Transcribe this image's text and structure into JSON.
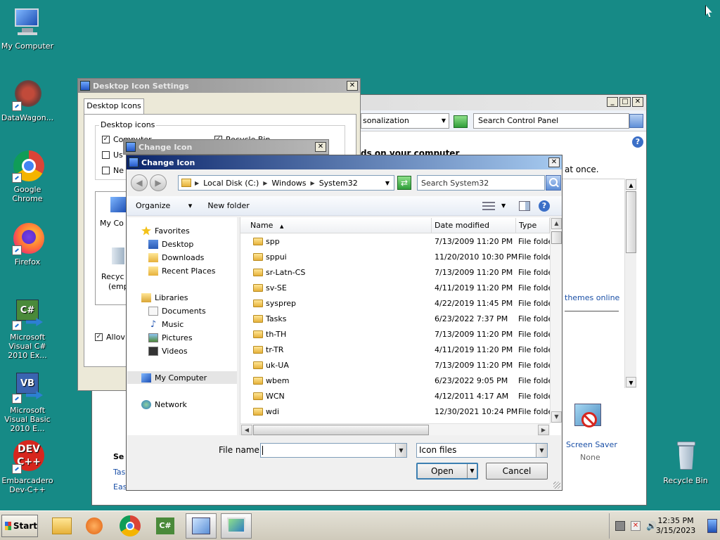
{
  "desktop": {
    "icons": [
      {
        "label": "My Computer"
      },
      {
        "label": "DataWagon..."
      },
      {
        "label": "Google Chrome"
      },
      {
        "label": "Firefox"
      },
      {
        "label": "Microsoft Visual C# 2010 Ex..."
      },
      {
        "label": "Microsoft Visual Basic 2010 E..."
      },
      {
        "label": "Embarcadero Dev-C++"
      },
      {
        "label": "Recycle Bin"
      }
    ]
  },
  "personalization_window": {
    "breadcrumb_tail": "sonalization",
    "search_placeholder": "Search Control Panel",
    "heading_fragment": "ds on your computer",
    "text_fragment": "at once.",
    "themes_link": "themes online",
    "screen_saver_label": "Screen Saver",
    "screen_saver_value": "None",
    "left_fragments": [
      "Se",
      "Tas",
      "Eas"
    ]
  },
  "desktop_icon_settings": {
    "title": "Desktop Icon Settings",
    "tab": "Desktop Icons",
    "group_label": "Desktop icons",
    "checks": [
      "Computer",
      "Recycle Bin",
      "Us",
      "Ne"
    ],
    "preview_labels": [
      "My Co",
      "Recyc",
      "(emp"
    ],
    "allow_label": "Allov"
  },
  "change_icon_back": {
    "title": "Change Icon"
  },
  "change_icon": {
    "title": "Change Icon",
    "address": [
      "Local Disk (C:)",
      "Windows",
      "System32"
    ],
    "search_placeholder": "Search System32",
    "toolbar": {
      "organize": "Organize",
      "new_folder": "New folder"
    },
    "nav": {
      "favorites": "Favorites",
      "desktop": "Desktop",
      "downloads": "Downloads",
      "recent": "Recent Places",
      "libraries": "Libraries",
      "documents": "Documents",
      "music": "Music",
      "pictures": "Pictures",
      "videos": "Videos",
      "my_computer": "My Computer",
      "network": "Network"
    },
    "columns": {
      "name": "Name",
      "date": "Date modified",
      "type": "Type"
    },
    "rows": [
      {
        "name": "spp",
        "date": "7/13/2009 11:20 PM",
        "type": "File folder"
      },
      {
        "name": "sppui",
        "date": "11/20/2010 10:30 PM",
        "type": "File folder"
      },
      {
        "name": "sr-Latn-CS",
        "date": "7/13/2009 11:20 PM",
        "type": "File folder"
      },
      {
        "name": "sv-SE",
        "date": "4/11/2019 11:20 PM",
        "type": "File folder"
      },
      {
        "name": "sysprep",
        "date": "4/22/2019 11:45 PM",
        "type": "File folder"
      },
      {
        "name": "Tasks",
        "date": "6/23/2022 7:37 PM",
        "type": "File folder"
      },
      {
        "name": "th-TH",
        "date": "7/13/2009 11:20 PM",
        "type": "File folder"
      },
      {
        "name": "tr-TR",
        "date": "4/11/2019 11:20 PM",
        "type": "File folder"
      },
      {
        "name": "uk-UA",
        "date": "7/13/2009 11:20 PM",
        "type": "File folder"
      },
      {
        "name": "wbem",
        "date": "6/23/2022 9:05 PM",
        "type": "File folder"
      },
      {
        "name": "WCN",
        "date": "4/12/2011 4:17 AM",
        "type": "File folder"
      },
      {
        "name": "wdi",
        "date": "12/30/2021 10:24 PM",
        "type": "File folder"
      }
    ],
    "filename_label": "File name:",
    "filename_value": "",
    "filter_value": "Icon files",
    "open_label": "Open",
    "cancel_label": "Cancel"
  },
  "taskbar": {
    "start_label": "Start",
    "time": "12:35 PM",
    "date": "3/15/2023"
  }
}
